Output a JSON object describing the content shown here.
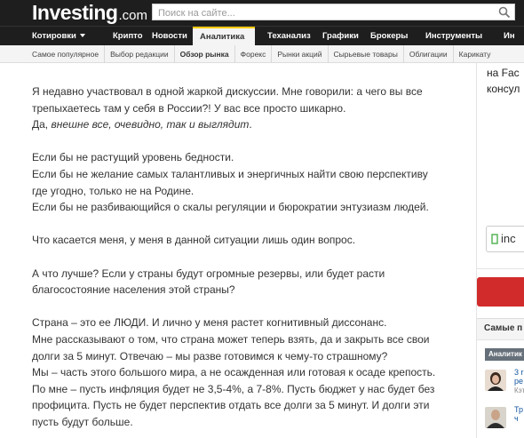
{
  "header": {
    "brand": "Investing",
    "tld": ".com",
    "search_placeholder": "Поиск на сайте..."
  },
  "main_nav": {
    "items": [
      {
        "label": "Котировки",
        "has_caret": true
      },
      {
        "label": "Крипто"
      },
      {
        "label": "Новости"
      },
      {
        "label": "Аналитика",
        "active": true
      },
      {
        "label": "Теханализ"
      },
      {
        "label": "Графики"
      },
      {
        "label": "Брокеры"
      },
      {
        "label": "Инструменты"
      },
      {
        "label": "Ин"
      }
    ]
  },
  "sub_nav": {
    "items": [
      {
        "label": "Самое популярное"
      },
      {
        "label": "Выбор редакции"
      },
      {
        "label": "Обзор рынка",
        "active": true
      },
      {
        "label": "Форекс"
      },
      {
        "label": "Рынки акций"
      },
      {
        "label": "Сырьевые товары"
      },
      {
        "label": "Облигации"
      },
      {
        "label": "Карикату"
      }
    ]
  },
  "article": {
    "paragraphs": [
      [
        "Я недавно участвовал в одной жаркой дискуссии. Мне говорили: а чего вы все",
        "трепыхаетесь там у себя в России?! У вас все просто шикарно.",
        {
          "prefix": "Да, ",
          "italic": "внешне все, очевидно, так и выглядит",
          "suffix": "."
        }
      ],
      [
        "Если бы не растущий уровень бедности.",
        "Если бы не желание самых талантливых и энергичных найти свою перспективу",
        "где угодно, только не на Родине.",
        "Если бы не разбивающийся о скалы регуляции и бюрократии энтузиазм людей."
      ],
      [
        "Что касается меня, у меня в данной ситуации лишь один вопрос."
      ],
      [
        "А что лучше? Если у страны будут огромные резервы, или будет расти",
        "благосостояние населения этой страны?"
      ],
      [
        "Страна – это ее ЛЮДИ. И лично у меня растет когнитивный диссонанс.",
        "Мне рассказывают о том, что страна может теперь взять, да и закрыть все свои",
        "долги за 5 минут. Отвечаю – мы разве готовимся к чему-то страшному?",
        "Мы – часть этого большого мира, а не осажденная или готовая к осаде крепость.",
        "По мне – пусть инфляция будет не 3,5-4%, а 7-8%. Пусть бюджет у нас будет без",
        "профицита. Пусть не будет перспектив отдать все долги за 5 минут. И долги эти",
        "пусть будут больше."
      ]
    ]
  },
  "right_column": {
    "partial_text_1": "на Fac",
    "partial_text_2": "консул",
    "widget_label": "inc",
    "panel_title": "Самые п",
    "panel_tab": "Аналитик",
    "items": [
      {
        "line1": "3 r",
        "line2": "ре",
        "line3": "Кэт"
      },
      {
        "line1": "Тр",
        "line2": "ч",
        "line3": "..."
      }
    ]
  },
  "colors": {
    "header_bg": "#1e1e1e",
    "accent": "#ffcc00",
    "link": "#1256a0",
    "red_button": "#d22b2b"
  }
}
